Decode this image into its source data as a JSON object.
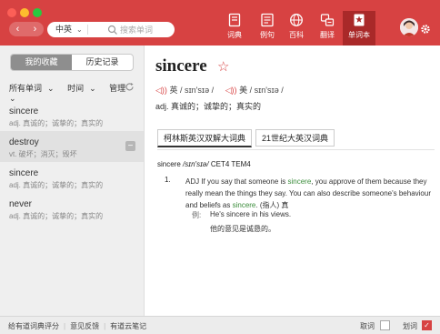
{
  "colors": {
    "accent": "#d74242",
    "accent_dark": "#a92929",
    "highlight_green": "#3b8c3b"
  },
  "nav": {
    "back": "‹",
    "forward": "›"
  },
  "search": {
    "lang": "中英",
    "placeholder": "搜索单词"
  },
  "toolbar": [
    {
      "label": "词典",
      "icon": "dictionary-icon"
    },
    {
      "label": "例句",
      "icon": "example-sentences-icon"
    },
    {
      "label": "百科",
      "icon": "encyclopedia-icon"
    },
    {
      "label": "翻译",
      "icon": "translate-icon"
    },
    {
      "label": "单词本",
      "icon": "wordbook-icon",
      "active": true
    }
  ],
  "sidebar": {
    "tabs": {
      "favorites": "我的收藏",
      "history": "历史记录"
    },
    "filters": {
      "all_words": "所有单词",
      "time": "时间",
      "manage": "管理"
    },
    "words": [
      {
        "word": "sincere",
        "def": "adj. 真诚的；诚挚的；真实的"
      },
      {
        "word": "destroy",
        "def": "vt. 破坏；消灭；毁坏",
        "selected": true
      },
      {
        "word": "sincere",
        "def": "adj. 真诚的；诚挚的；真实的"
      },
      {
        "word": "never",
        "def": "adj. 真诚的；诚挚的；真实的"
      }
    ]
  },
  "entry": {
    "headword": "sincere",
    "pron_uk_label": "英",
    "pron_uk": "/ sɪn'sɪə /",
    "pron_us_label": "美",
    "pron_us": "/ sɪn'sɪə /",
    "meaning": "adj. 真诚的；诚挚的；真实的",
    "dict_tabs": [
      "柯林斯英汉双解大词典",
      "21世纪大英汉词典"
    ],
    "collins": {
      "head": "sincere",
      "phonetic": "/sɪn'sɪə/",
      "tags": "CET4 TEM4",
      "sense_num": "1.",
      "sense_part1": "ADJ If you say that someone is ",
      "sense_hl1": "sincere",
      "sense_part2": ", you approve of them because they really mean the things they say. You can also describe someone's behaviour and beliefs as ",
      "sense_hl2": "sincere",
      "sense_part3": ". (指人) 真",
      "example_label": "例:",
      "example_en": "He's sincere in his views.",
      "example_zh": "他的意见是诚恳的。"
    }
  },
  "status": {
    "rate": "给有道词典评分",
    "feedback": "意见反馈",
    "cloud": "有道云笔记",
    "fetch_label": "取词",
    "fetch_checked": false,
    "select_label": "划词",
    "select_checked": true
  }
}
